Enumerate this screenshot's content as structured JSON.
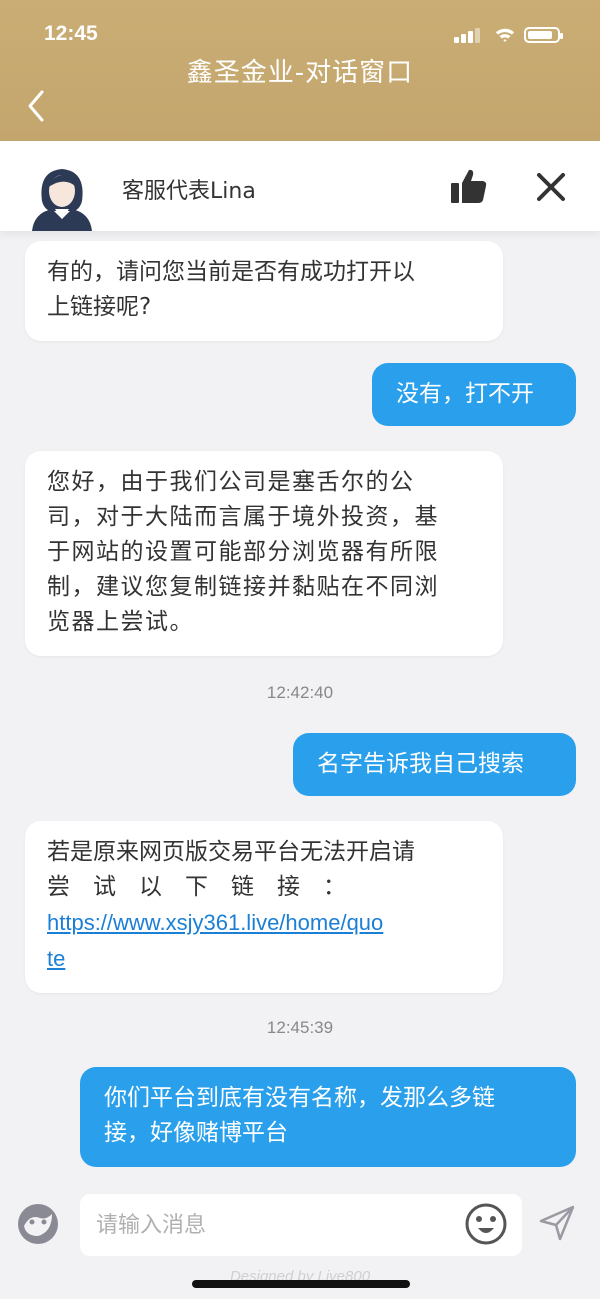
{
  "status": {
    "time": "12:45",
    "battery_level": 0.85
  },
  "header": {
    "title": "鑫圣金业-对话窗口"
  },
  "agent": {
    "name": "客服代表Lina"
  },
  "messages": [
    {
      "side": "left",
      "lines": [
        "有的，请问您当前是否有成功打开以",
        "上链接呢?"
      ]
    },
    {
      "side": "right",
      "lines": [
        "没有，打不开"
      ]
    },
    {
      "side": "left",
      "lines": [
        "您好，由于我们公司是塞舌尔的公",
        "司，对于大陆而言属于境外投资，基",
        "于网站的设置可能部分浏览器有所限",
        "制，建议您复制链接并黏贴在不同浏",
        "览器上尝试。"
      ]
    },
    {
      "timestamp": "12:42:40"
    },
    {
      "side": "right",
      "lines": [
        "名字告诉我自己搜索"
      ]
    },
    {
      "side": "left",
      "lines": [
        "若是原来网页版交易平台无法开启请",
        "尝　试　以　下　链　接　："
      ],
      "link_lines": [
        "https://www.xsjy361.live/home/quo",
        "te"
      ]
    },
    {
      "timestamp": "12:45:39"
    },
    {
      "side": "right",
      "lines": [
        "你们平台到底有没有名称，发那么多链",
        "接，好像赌博平台"
      ]
    }
  ],
  "input": {
    "placeholder": "请输入消息"
  },
  "footer": {
    "designed_by": "Designed by Live800"
  },
  "colors": {
    "header_gold": "#c7ab72",
    "bubble_blue": "#2aa0ec",
    "link_blue": "#1c7fd6"
  }
}
